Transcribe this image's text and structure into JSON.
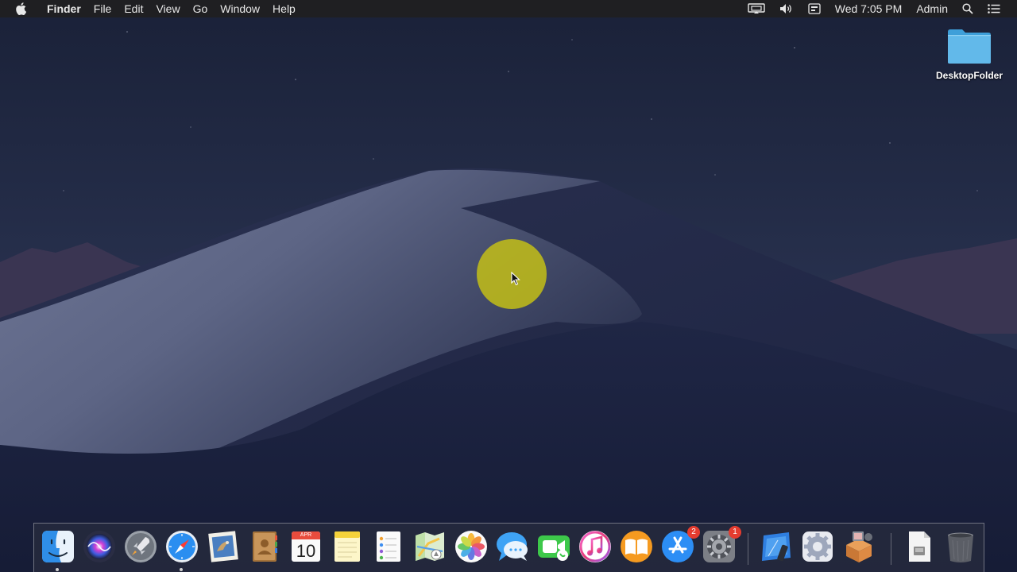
{
  "menubar": {
    "app_name": "Finder",
    "menus": [
      "File",
      "Edit",
      "View",
      "Go",
      "Window",
      "Help"
    ],
    "clock": "Wed 7:05 PM",
    "user": "Admin",
    "status_icons": [
      "display-mirroring-icon",
      "volume-icon",
      "input-menu-icon",
      "spotlight-search-icon",
      "notification-center-icon"
    ]
  },
  "desktop": {
    "folder_label": "DesktopFolder",
    "folder_color": "#5ab3e6"
  },
  "dock": {
    "apps": [
      {
        "name": "Finder",
        "icon": "finder-icon"
      },
      {
        "name": "Siri",
        "icon": "siri-icon"
      },
      {
        "name": "Launchpad",
        "icon": "launchpad-icon"
      },
      {
        "name": "Safari",
        "icon": "safari-icon"
      },
      {
        "name": "Mail",
        "icon": "mail-icon"
      },
      {
        "name": "Contacts",
        "icon": "contacts-icon"
      },
      {
        "name": "Calendar",
        "icon": "calendar-icon",
        "month": "APR",
        "day": "10"
      },
      {
        "name": "Notes",
        "icon": "notes-icon"
      },
      {
        "name": "Reminders",
        "icon": "reminders-icon"
      },
      {
        "name": "Maps",
        "icon": "maps-icon"
      },
      {
        "name": "Photos",
        "icon": "photos-icon"
      },
      {
        "name": "Messages",
        "icon": "messages-icon"
      },
      {
        "name": "FaceTime",
        "icon": "facetime-icon"
      },
      {
        "name": "iTunes",
        "icon": "itunes-icon"
      },
      {
        "name": "Books",
        "icon": "books-icon"
      },
      {
        "name": "App Store",
        "icon": "app-store-icon",
        "badge": "2"
      },
      {
        "name": "System Preferences",
        "icon": "system-preferences-icon",
        "badge": "1"
      },
      {
        "name": "Xcode",
        "icon": "xcode-icon"
      },
      {
        "name": "Network Utility",
        "icon": "gear-icon"
      },
      {
        "name": "Installer",
        "icon": "installer-icon"
      },
      {
        "name": "Document",
        "icon": "document-icon"
      },
      {
        "name": "Trash",
        "icon": "trash-icon"
      }
    ]
  },
  "colors": {
    "menubar_bg": "#1f1f22",
    "badge": "#e53c2f",
    "cursor_highlight": "#c8c314"
  }
}
